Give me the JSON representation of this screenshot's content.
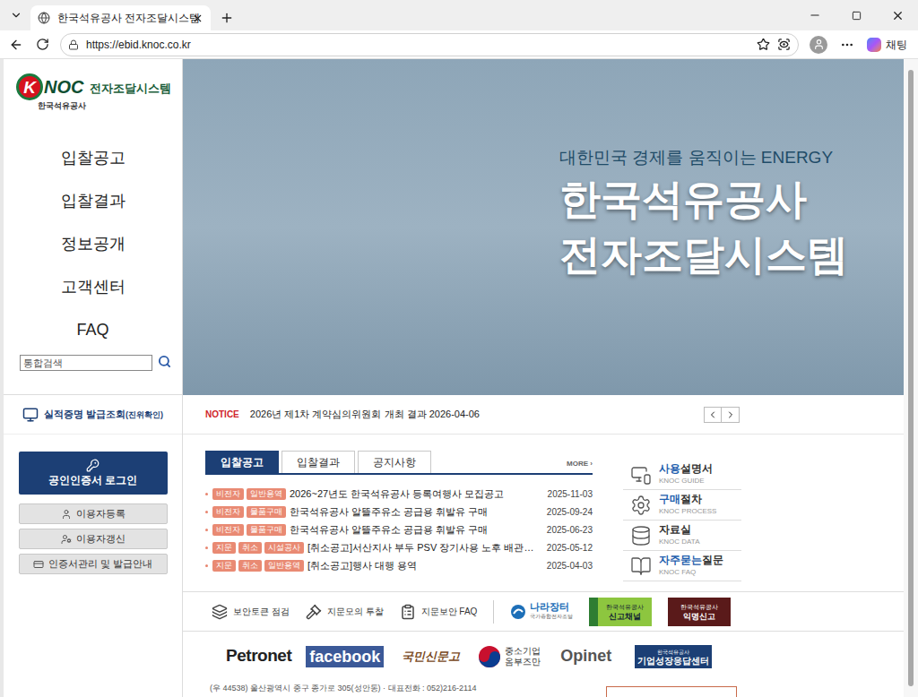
{
  "browser": {
    "tab_title": "한국석유공사 전자조달시스템",
    "url": "https://ebid.knoc.co.kr",
    "copilot_label": "채팅"
  },
  "logo": {
    "mark_letter": "K",
    "mark_rest": "NOC",
    "title": "전자조달시스템",
    "subtitle": "한국석유공사"
  },
  "menu": [
    "입찰공고",
    "입찰결과",
    "정보공개",
    "고객센터",
    "FAQ"
  ],
  "search": {
    "placeholder": "통합검색"
  },
  "certificate_link": {
    "label": "실적증명 발급조회",
    "suffix": "(진위확인)"
  },
  "login": {
    "label": "공인인증서 로그인"
  },
  "user_buttons": [
    "이용자등록",
    "이용자갱신",
    "인증서관리 및 발급안내"
  ],
  "hero": {
    "tagline": "대한민국 경제를 움직이는 ENERGY",
    "title_lines": [
      "한국석유공사",
      "전자조달시스템"
    ]
  },
  "notice": {
    "label": "NOTICE",
    "text": "2026년 제1차 계약심의위원회 개최 결과",
    "date": "2026-04-06"
  },
  "board": {
    "tabs": [
      {
        "label": "입찰공고",
        "selected": true
      },
      {
        "label": "입찰결과",
        "selected": false
      },
      {
        "label": "공지사항",
        "selected": false
      }
    ],
    "more": "MORE ›",
    "rows": [
      {
        "tags": [
          "비전자",
          "일반용역"
        ],
        "title": "2026~27년도 한국석유공사 등록여행사 모집공고",
        "date": "2025-11-03"
      },
      {
        "tags": [
          "비전자",
          "물품구매"
        ],
        "title": "한국석유공사 알뜰주유소 공급용 휘발유 구매",
        "date": "2025-09-24"
      },
      {
        "tags": [
          "비전자",
          "물품구매"
        ],
        "title": "한국석유공사 알뜰주유소 공급용 휘발유 구매",
        "date": "2025-06-23"
      },
      {
        "tags": [
          "지문",
          "취소",
          "시설공사"
        ],
        "title": "[취소공고]서산지사 부두 PSV 장기사용 노후 배관…",
        "date": "2025-05-12"
      },
      {
        "tags": [
          "지문",
          "취소",
          "일반용역"
        ],
        "title": "[취소공고]행사 대행 용역",
        "date": "2025-04-03"
      }
    ]
  },
  "quick_links": [
    {
      "segments": [
        {
          "text": "사용",
          "highlight": true
        },
        {
          "text": "설명서",
          "highlight": false
        }
      ],
      "sub": "KNOC GUIDE"
    },
    {
      "segments": [
        {
          "text": "구매",
          "highlight": true
        },
        {
          "text": "절차",
          "highlight": false
        }
      ],
      "sub": "KNOC PROCESS"
    },
    {
      "segments": [
        {
          "text": "자료실",
          "highlight": false
        }
      ],
      "sub": "KNOC DATA"
    },
    {
      "segments": [
        {
          "text": "자주묻는",
          "highlight": true
        },
        {
          "text": "질문",
          "highlight": false
        }
      ],
      "sub": "KNOC FAQ"
    }
  ],
  "tools": [
    "보안토큰 점검",
    "지문모의 투찰",
    "지문보안 FAQ"
  ],
  "banners": {
    "nara": {
      "title": "나라장터",
      "sub": "국가종합전자조달"
    },
    "report": {
      "top": "한국석유공사",
      "bottom": "신고채널"
    },
    "anonymous": {
      "top": "한국석유공사",
      "bottom": "익명신고"
    }
  },
  "partners": {
    "petronet": "Petronet",
    "facebook": "facebook",
    "sinmungo": "국민신문고",
    "ombudsman_top": "중소기업",
    "ombudsman_bottom": "옴부즈만",
    "opinet": "Opinet",
    "growth_top": "한국석유공사",
    "growth": "기업성장응답센터"
  },
  "footer": {
    "address": "(우 44538) 울산광역시 중구 종가로 305(성안동) · 대표전화 : 052)216-2114"
  }
}
